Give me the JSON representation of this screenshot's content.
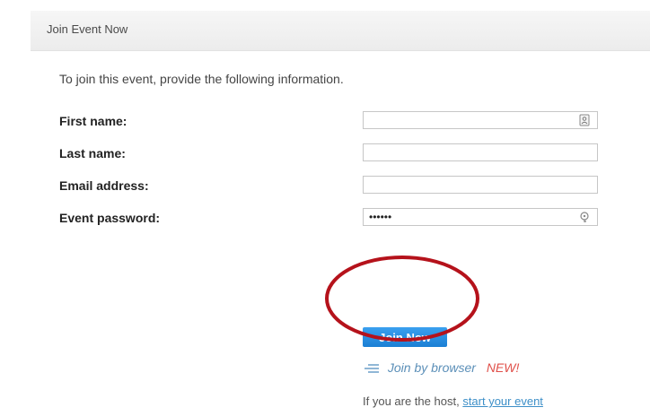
{
  "header": {
    "title": "Join Event Now"
  },
  "form": {
    "intro": "To join this event, provide the following information.",
    "fields": [
      {
        "label": "First name:",
        "value": "",
        "placeholder": "",
        "icon": "contact-card-icon"
      },
      {
        "label": "Last name:",
        "value": "",
        "placeholder": ""
      },
      {
        "label": "Email address:",
        "value": "",
        "placeholder": ""
      },
      {
        "label": "Event password:",
        "value": "••••••",
        "icon": "key-icon"
      }
    ]
  },
  "actions": {
    "join_label": "Join Now",
    "browser_label": "Join by browser",
    "browser_badge": "NEW!",
    "host_prefix": "If you are the host,",
    "host_link": "start your event"
  },
  "colors": {
    "accent": "#1b7fd4",
    "annotation": "#b5121b",
    "new_badge": "#e0504a",
    "link": "#3d8fc8"
  }
}
